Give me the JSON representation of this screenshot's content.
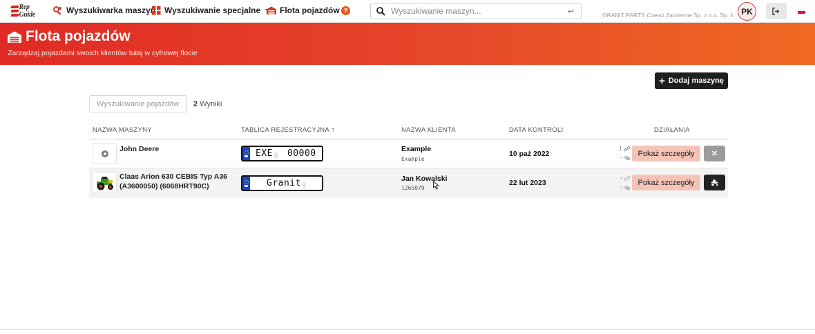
{
  "nav": {
    "logo_text": "Rep Guide",
    "items": [
      {
        "label": "Wyszukiwarka maszyn",
        "icon": "wrench-cog-icon"
      },
      {
        "label": "Wyszukiwanie specjalne",
        "icon": "grid-icon"
      },
      {
        "label": "Flota pojazdów",
        "icon": "garage-icon"
      }
    ],
    "search_placeholder": "Wyszukiwanie maszyn...",
    "company": "GRANIT PARTS Czesci Zamienne Sp. z o.o. Sp. k",
    "avatar_initials": "PK",
    "colors": {
      "brand": "#e02a24",
      "help": "#e8541c"
    }
  },
  "banner": {
    "title": "Flota pojazdów",
    "subtitle": "Zarządzaj pojazdami swoich klientów tutaj w cyfrowej flocie"
  },
  "toolbar": {
    "add_label": "Dodaj maszynę",
    "search_placeholder": "Wyszukiwanie pojazdów",
    "result_count": "2",
    "result_label": "Wyniki"
  },
  "table": {
    "headers": [
      "NAZWA MASZYNY",
      "TABLICA REJESTRACYJNA",
      "NAZWA KLIENTA",
      "DATA KONTROLI",
      "DZIAŁANIA"
    ],
    "sort_indicator": "↑",
    "rows": [
      {
        "machine": "John Deere",
        "plate_left": "EXE",
        "plate_right": "00000",
        "client": "Example",
        "client_sub": "Example",
        "date": "10 paź 2022",
        "link_count": "1",
        "comment_count": "-",
        "details_label": "Pokaż szczegóły"
      },
      {
        "machine_line1": "Claas Arion 630 CEBIS Typ A36",
        "machine_line2": "(A3600050) (6068HRT90C)",
        "plate_left": "Granit",
        "plate_right": "",
        "client": "Jan Kowalski",
        "client_sub": "1265079",
        "date": "22 lut 2023",
        "link_count": "-",
        "comment_count": "-",
        "details_label": "Pokaż szczegóły"
      }
    ]
  }
}
